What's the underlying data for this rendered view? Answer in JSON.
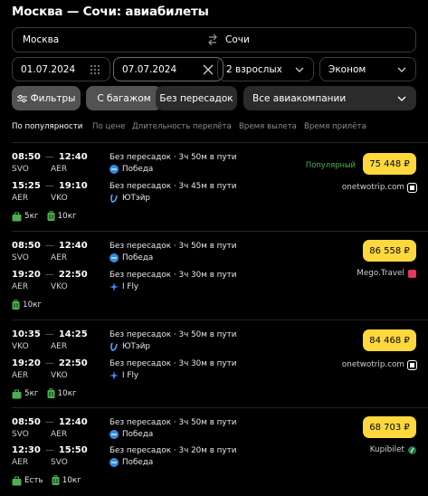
{
  "title": "Москва — Сочи: авиабилеты",
  "route": {
    "from": "Москва",
    "to": "Сочи"
  },
  "dates": {
    "depart": "01.07.2024",
    "return": "07.07.2024"
  },
  "passengers": "2 взрослых",
  "cabin": "Эконом",
  "chips": {
    "filters": "Фильтры",
    "baggage": "С багажом",
    "nonstop": "Без пересадок",
    "airlines": "Все авиакомпании"
  },
  "sort": [
    "По популярности",
    "По цене",
    "Длительность перелёта",
    "Время вылета",
    "Время прилёта"
  ],
  "colors": {
    "accent": "#ffd83d",
    "popular": "#4caf50"
  },
  "results": [
    {
      "price": "75 448 ₽",
      "badge": "Популярный",
      "seller": "onetwotrip.com",
      "legs": [
        {
          "dep": "08:50",
          "arr": "12:40",
          "from": "SVO",
          "to": "AER",
          "info": "Без пересадок · 3ч 50м в пути",
          "airline": "Победа",
          "logo": "pobeda"
        },
        {
          "dep": "15:25",
          "arr": "19:10",
          "from": "AER",
          "to": "VKO",
          "info": "Без пересадок · 3ч 45м в пути",
          "airline": "ЮТэйр",
          "logo": "utair"
        }
      ],
      "bags": [
        {
          "icon": "suitcase-icon",
          "text": "5кг"
        },
        {
          "icon": "luggage-icon",
          "text": "10кг"
        }
      ]
    },
    {
      "price": "86 558 ₽",
      "badge": "",
      "seller": "Mego.Travel",
      "legs": [
        {
          "dep": "08:50",
          "arr": "12:40",
          "from": "SVO",
          "to": "AER",
          "info": "Без пересадок · 3ч 50м в пути",
          "airline": "Победа",
          "logo": "pobeda"
        },
        {
          "dep": "19:20",
          "arr": "22:50",
          "from": "AER",
          "to": "VKO",
          "info": "Без пересадок · 3ч 30м в пути",
          "airline": "I Fly",
          "logo": "ifly"
        }
      ],
      "bags": [
        {
          "icon": "luggage-icon",
          "text": "10кг"
        }
      ]
    },
    {
      "price": "84 468 ₽",
      "badge": "",
      "seller": "onetwotrip.com",
      "legs": [
        {
          "dep": "10:35",
          "arr": "14:25",
          "from": "VKO",
          "to": "AER",
          "info": "Без пересадок · 3ч 50м в пути",
          "airline": "ЮТэйр",
          "logo": "utair"
        },
        {
          "dep": "19:20",
          "arr": "22:50",
          "from": "AER",
          "to": "VKO",
          "info": "Без пересадок · 3ч 30м в пути",
          "airline": "I Fly",
          "logo": "ifly"
        }
      ],
      "bags": [
        {
          "icon": "suitcase-icon",
          "text": "5кг"
        },
        {
          "icon": "luggage-icon",
          "text": "10кг"
        }
      ]
    },
    {
      "price": "68 703 ₽",
      "badge": "",
      "seller": "Kupibilet",
      "legs": [
        {
          "dep": "08:50",
          "arr": "12:40",
          "from": "SVO",
          "to": "AER",
          "info": "Без пересадок · 3ч 50м в пути",
          "airline": "Победа",
          "logo": "pobeda"
        },
        {
          "dep": "12:30",
          "arr": "15:50",
          "from": "AER",
          "to": "SVO",
          "info": "Без пересадок · 3ч 20м в пути",
          "airline": "Победа",
          "logo": "pobeda"
        }
      ],
      "bags": [
        {
          "icon": "suitcase-icon",
          "text": "Есть"
        },
        {
          "icon": "luggage-icon",
          "text": "10кг"
        }
      ]
    }
  ]
}
